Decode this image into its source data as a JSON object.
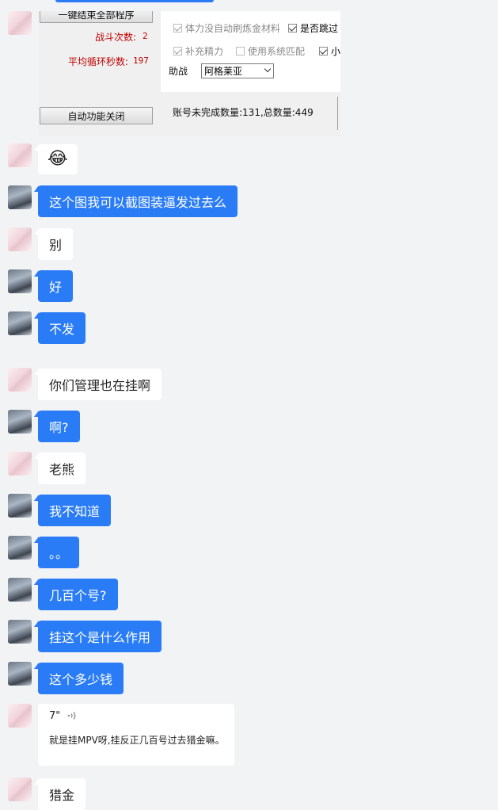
{
  "screenshot_panel": {
    "top_button_label": "一键结束全部程序",
    "battle_count_label": "战斗次数:",
    "battle_count_value": "2",
    "avg_cycle_label": "平均循环秒数:",
    "avg_cycle_value": "197",
    "auto_off_button": "自动功能关闭",
    "checkbox_stamina": "体力没自动刷炼金材料",
    "checkbox_skip": "是否跳过",
    "checkbox_refill": "补充精力",
    "checkbox_match": "使用系统匹配",
    "checkbox_small": "小",
    "assist_label": "助战",
    "assist_select_value": "阿格莱亚",
    "status_text": "账号未完成数量:131,总数量:449"
  },
  "messages": [
    {
      "side": "in",
      "text": "😂"
    },
    {
      "side": "out",
      "text": "这个图我可以截图装逼发过去么"
    },
    {
      "side": "in",
      "text": "别"
    },
    {
      "side": "out",
      "text": "好"
    },
    {
      "side": "out",
      "text": "不发"
    },
    {
      "side": "in",
      "text": "你们管理也在挂啊"
    },
    {
      "side": "out",
      "text": "啊?"
    },
    {
      "side": "in",
      "text": "老熊"
    },
    {
      "side": "out",
      "text": "我不知道"
    },
    {
      "side": "out",
      "text": "。。"
    },
    {
      "side": "out",
      "text": "几百个号?"
    },
    {
      "side": "out",
      "text": "挂这个是什么作用"
    },
    {
      "side": "out",
      "text": "这个多少钱"
    },
    {
      "side": "in",
      "text": "猎金"
    }
  ],
  "voice_message": {
    "duration": "7\"",
    "wave_icon": "voice-wave-icon",
    "transcript": "就是挂MPV呀,挂反正几百号过去猎金嘛。"
  },
  "colors": {
    "background": "#f2f3f5",
    "outgoing_bubble": "#2a7cf6",
    "incoming_bubble": "#ffffff",
    "stat_red": "#c00000"
  }
}
